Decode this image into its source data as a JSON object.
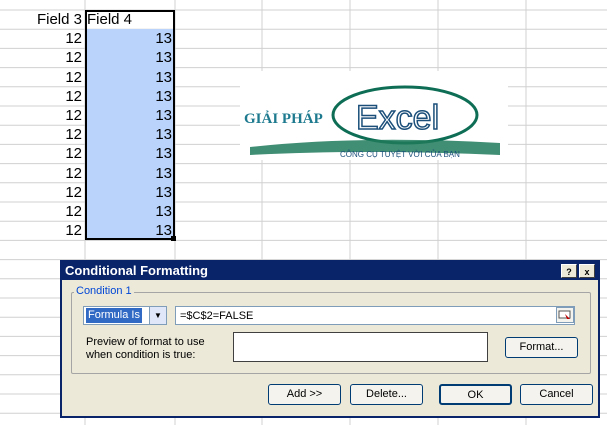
{
  "sheet": {
    "col3_header": "Field 3",
    "col4_header": "Field 4",
    "col3_values": [
      "12",
      "12",
      "12",
      "12",
      "12",
      "12",
      "12",
      "12",
      "12",
      "12",
      "12"
    ],
    "col4_values": [
      "13",
      "13",
      "13",
      "13",
      "13",
      "13",
      "13",
      "13",
      "13",
      "13",
      "13"
    ],
    "selection_color": "#b9d3fb"
  },
  "logo": {
    "brand_left": "GIẢI PHÁP",
    "brand_main": "Excel",
    "tagline": "CÔNG CỤ TUYỆT VỜI CỦA BẠN"
  },
  "dialog": {
    "title": "Conditional Formatting",
    "condition_label": "Condition 1",
    "condition_type": "Formula Is",
    "formula": "=$C$2=FALSE",
    "preview_label_line1": "Preview of format to use",
    "preview_label_line2": "when condition is true:",
    "format_button": "Format...",
    "add_button": "Add >>",
    "delete_button": "Delete...",
    "ok_button": "OK",
    "cancel_button": "Cancel",
    "help_glyph": "?",
    "close_glyph": "x"
  }
}
